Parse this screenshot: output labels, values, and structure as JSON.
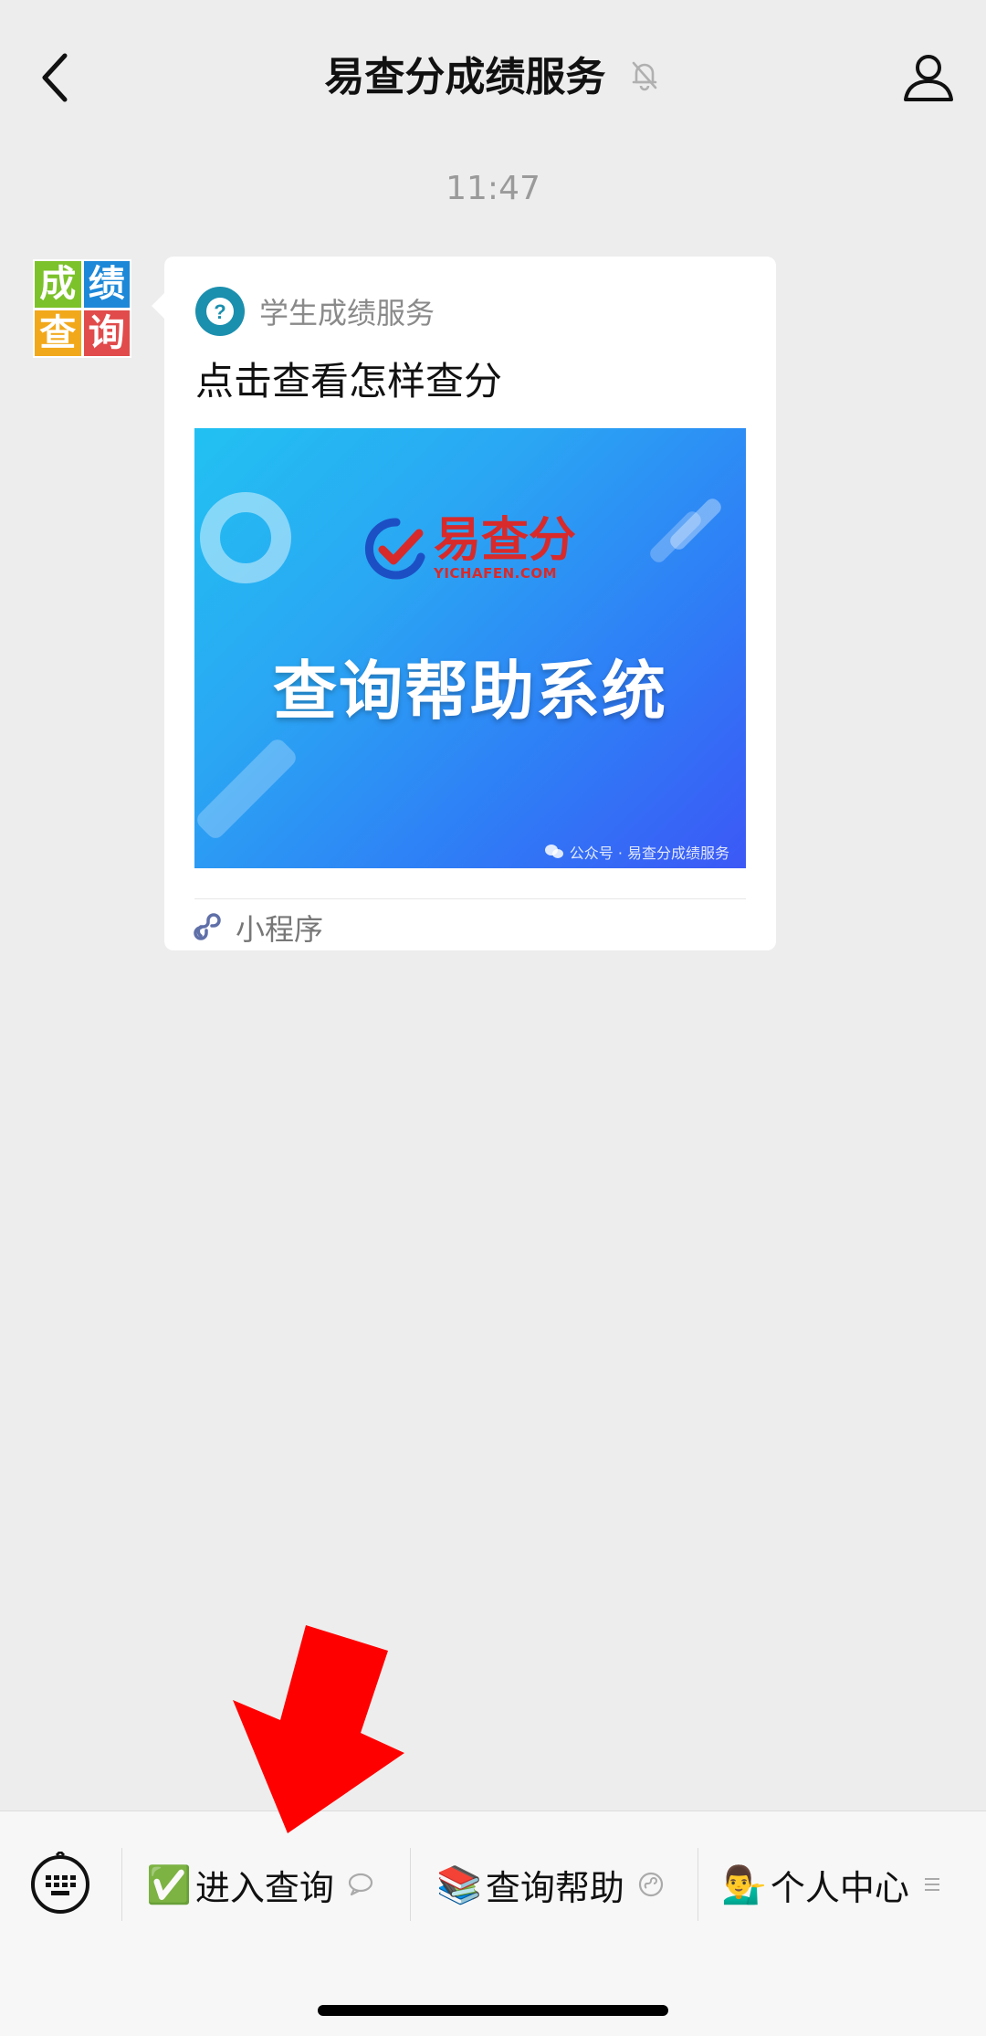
{
  "header": {
    "title": "易查分成绩服务",
    "back_icon": "chevron-left-icon",
    "mute_icon": "bell-off-icon",
    "profile_icon": "person-icon"
  },
  "chat": {
    "timestamp": "11:47",
    "avatar_chars": [
      "成",
      "绩",
      "查",
      "询"
    ],
    "avatar_colors": [
      "#7cc22a",
      "#1e88d8",
      "#f2a81b",
      "#e14b4b"
    ],
    "card": {
      "source_name": "学生成绩服务",
      "title": "点击查看怎样查分",
      "banner": {
        "logo_cn": "易查分",
        "logo_en": "YICHAFEN.COM",
        "headline": "查询帮助系统",
        "footer": "公众号 · 易查分成绩服务"
      },
      "type_label": "小程序"
    }
  },
  "bottom_menu": {
    "keyboard_icon": "keyboard-icon",
    "items": [
      {
        "emoji": "✅",
        "label": "进入查询",
        "suffix_icon": "chat-bubble-icon"
      },
      {
        "emoji": "📚",
        "label": "查询帮助",
        "suffix_icon": "mini-program-icon"
      },
      {
        "emoji": "💁‍♂️",
        "label": "个人中心",
        "suffix_icon": "menu-lines-icon"
      }
    ]
  },
  "colors": {
    "background": "#ededed",
    "arrow_annotation": "#ff0000",
    "banner_gradient_start": "#22c1f2",
    "banner_gradient_end": "#3c58f6"
  }
}
